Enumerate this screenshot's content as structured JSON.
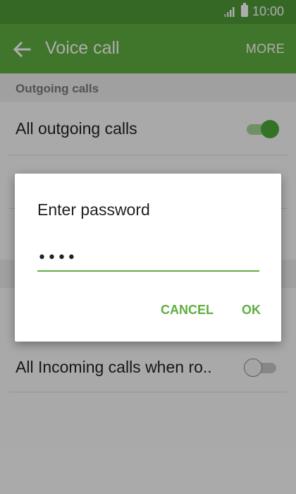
{
  "status_bar": {
    "time": "10:00"
  },
  "app_bar": {
    "title": "Voice call",
    "more_label": "MORE",
    "back_icon": "arrow-left-icon"
  },
  "section": {
    "header": "Outgoing calls"
  },
  "rows": [
    {
      "label": "All outgoing calls",
      "toggle_on": true
    },
    {
      "label": "",
      "toggle_on": false
    },
    {
      "label": "All Incoming calls when ro..",
      "toggle_on": false
    }
  ],
  "dialog": {
    "title": "Enter password",
    "password_value": "••••",
    "cancel_label": "CANCEL",
    "ok_label": "OK"
  },
  "colors": {
    "app_bar": "#5fae40",
    "status_bar": "#4f9a37",
    "accent": "#5fae40"
  }
}
